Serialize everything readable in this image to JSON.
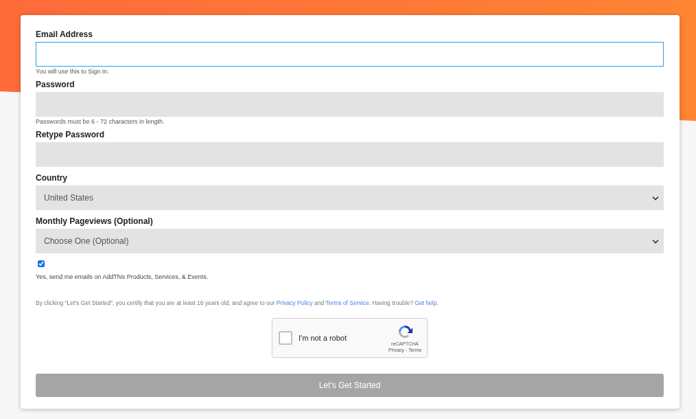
{
  "fields": [
    {
      "kind": "text",
      "label": "Email Address",
      "focused": true,
      "hint": "You will use this to Sign In."
    },
    {
      "kind": "password",
      "label": "Password",
      "focused": false,
      "hint": "Passwords must be 6 - 72 characters in length."
    },
    {
      "kind": "password",
      "label": "Retype Password",
      "focused": false
    },
    {
      "kind": "select",
      "label": "Country",
      "focused": false,
      "value": "United States"
    },
    {
      "kind": "select",
      "label": "Monthly Pageviews (Optional)",
      "focused": false,
      "value": "Choose One (Optional)"
    }
  ],
  "newsletter": {
    "checked": true,
    "label": "Yes, send me emails on AddThis Products, Services, & Events."
  },
  "legal": [
    {
      "kind": "text",
      "text": "By clicking \"Let's Get Started\", you certify that you are at least 16 years old, and agree to our "
    },
    {
      "kind": "link",
      "text": "Privacy Policy"
    },
    {
      "kind": "text",
      "text": " and "
    },
    {
      "kind": "link",
      "text": "Terms of Service"
    },
    {
      "kind": "text",
      "text": ". Having trouble? "
    },
    {
      "kind": "link",
      "text": "Get help."
    }
  ],
  "captcha": {
    "checked": false,
    "label": "I'm not a robot",
    "brand": "reCAPTCHA",
    "links": "Privacy - Terms"
  },
  "submit": {
    "label": "Let's Get Started"
  }
}
